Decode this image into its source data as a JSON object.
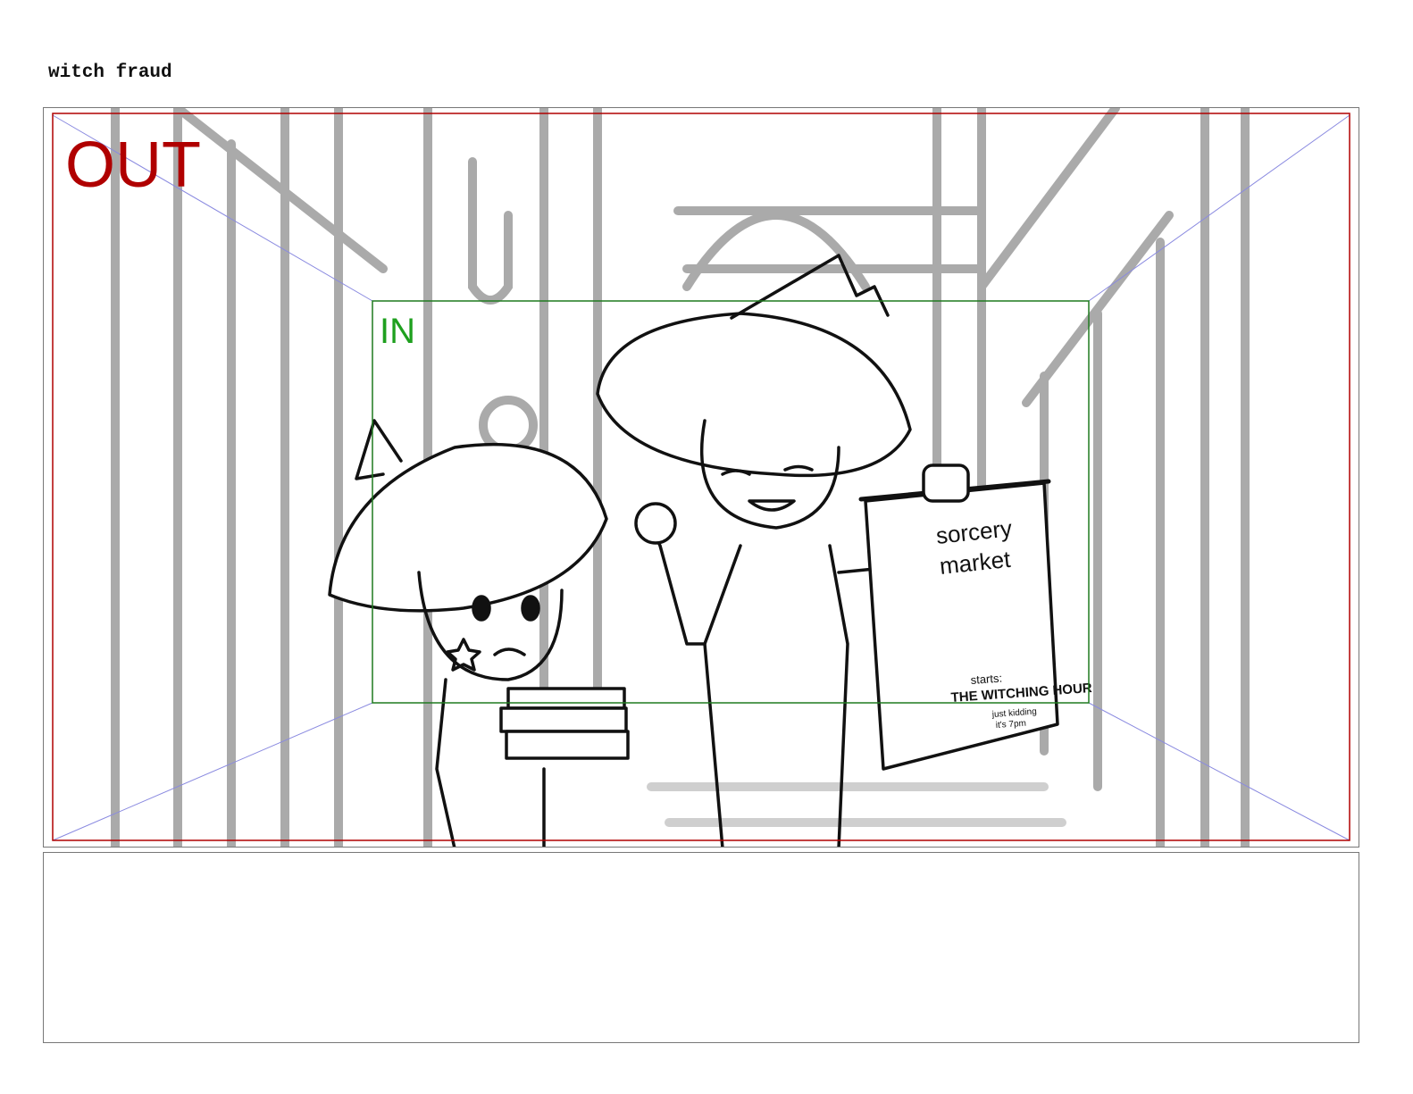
{
  "header": {
    "title": "witch fraud"
  },
  "frame": {
    "out_label": "OUT",
    "in_label": "IN",
    "out_color": "#b00000",
    "in_color": "#1fa01f"
  },
  "poster": {
    "line1": "sorcery",
    "line2": "market",
    "starts": "starts:",
    "time": "THE WITCHING HOUR",
    "note1": "just kidding",
    "note2": "it's 7pm"
  },
  "notes": {
    "text": ""
  }
}
